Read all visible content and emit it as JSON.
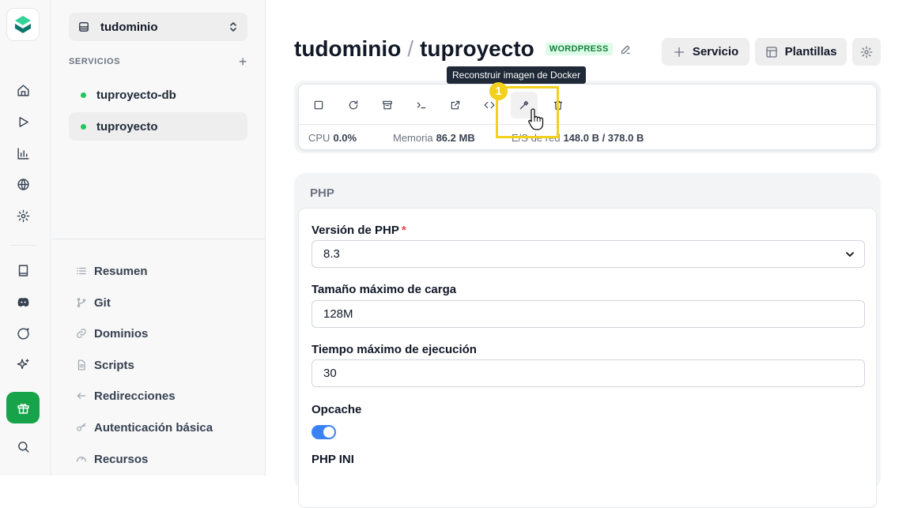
{
  "app": {
    "brand_color": "#16a34a",
    "accent": "#3b82f6"
  },
  "rail": {
    "icons": [
      "logo-icon",
      "home-icon",
      "play-icon",
      "chart-icon",
      "globe-icon",
      "gear-icon",
      "book-icon",
      "discord-icon",
      "chat-icon",
      "sparkles-icon",
      "gift-icon",
      "search-icon"
    ]
  },
  "sidebar": {
    "project_selector": "tudominio",
    "services_header": "SERVICIOS",
    "services": [
      {
        "label": "tuproyecto-db",
        "status": "running",
        "active": false
      },
      {
        "label": "tuproyecto",
        "status": "running",
        "active": true
      }
    ],
    "nav": [
      {
        "label": "Resumen",
        "icon": "list-icon"
      },
      {
        "label": "Git",
        "icon": "git-branch-icon"
      },
      {
        "label": "Dominios",
        "icon": "link-icon"
      },
      {
        "label": "Scripts",
        "icon": "file-icon"
      },
      {
        "label": "Redirecciones",
        "icon": "arrow-left-icon"
      },
      {
        "label": "Autenticación básica",
        "icon": "key-icon"
      },
      {
        "label": "Recursos",
        "icon": "gauge-icon"
      }
    ]
  },
  "header": {
    "project": "tudominio",
    "separator": "/",
    "service": "tuproyecto",
    "badge": "WORDPRESS",
    "buttons": {
      "service": "Servicio",
      "templates": "Plantillas"
    }
  },
  "controls": {
    "tooltip": "Reconstruir imagen de Docker",
    "actions": [
      "stop-icon",
      "restart-icon",
      "archive-icon",
      "terminal-icon",
      "external-link-icon",
      "code-icon",
      "hammer-icon",
      "trash-icon"
    ],
    "stats": {
      "cpu_label": "CPU",
      "cpu_value": "0.0%",
      "mem_label": "Memoria",
      "mem_value": "86.2 MB",
      "net_label": "E/S de red",
      "net_value": "148.0 B / 378.0 B"
    },
    "marker": "1"
  },
  "php": {
    "title": "PHP",
    "version_label": "Versión de PHP",
    "version_required": "*",
    "version_value": "8.3",
    "upload_label": "Tamaño máximo de carga",
    "upload_value": "128M",
    "exec_label": "Tiempo máximo de ejecución",
    "exec_value": "30",
    "opcache_label": "Opcache",
    "opcache_on": true,
    "ini_label": "PHP INI"
  }
}
